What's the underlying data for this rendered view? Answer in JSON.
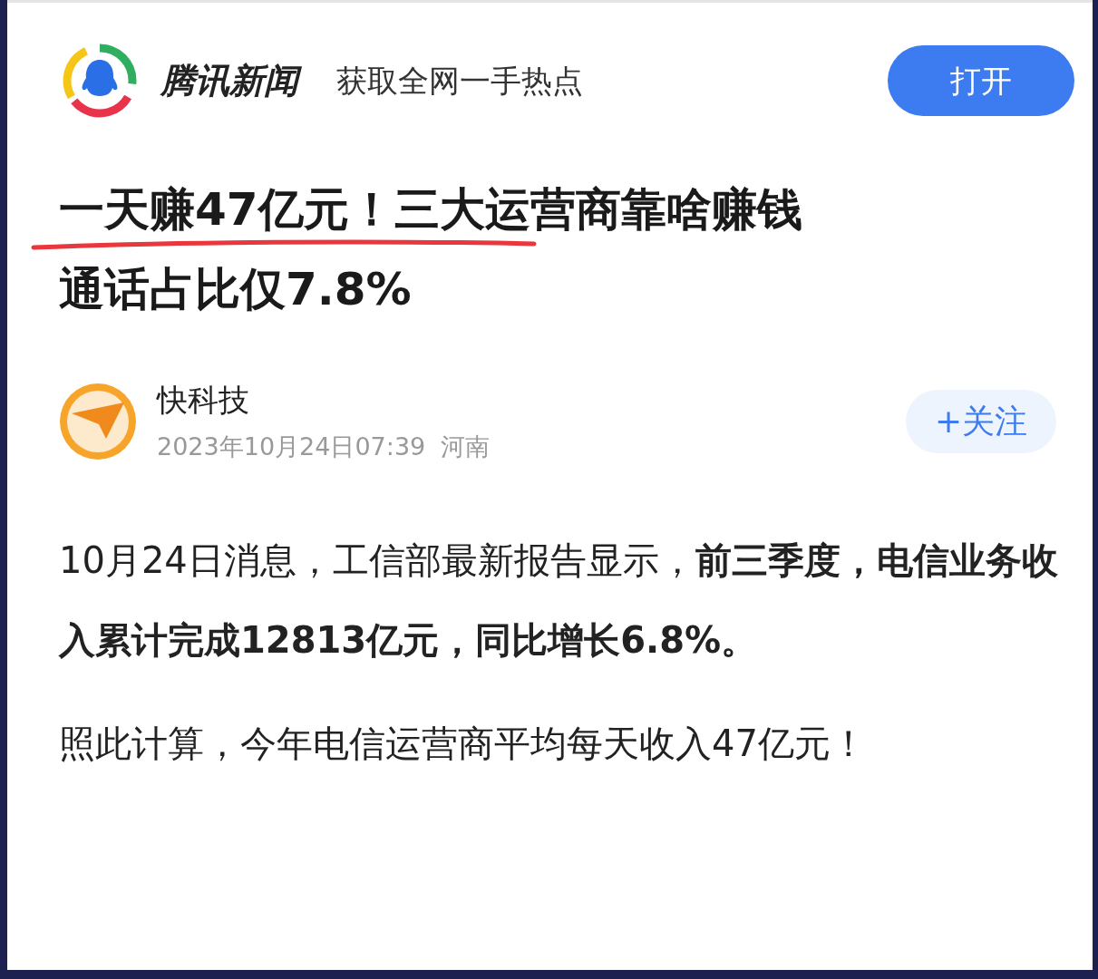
{
  "header": {
    "brand": "腾讯新闻",
    "slogan": "获取全网一手热点",
    "open_button": "打开"
  },
  "article": {
    "title_lines": [
      "一天赚47亿元！三大运营商靠啥赚钱",
      "通话占比仅7.8%"
    ],
    "author": {
      "name": "快科技",
      "meta": "2023年10月24日07:39  河南",
      "follow_button": "+关注"
    },
    "paragraphs": [
      "10月24日消息，工信部最新报告显示，**前三季度，电信业务收入累计完成12813亿元，同比增长6.8%。**",
      "照此计算，今年电信运营商平均每天收入47亿元！"
    ]
  }
}
